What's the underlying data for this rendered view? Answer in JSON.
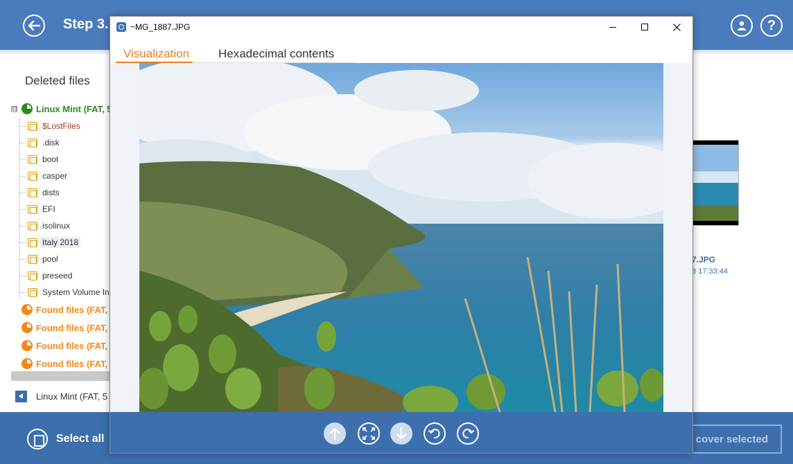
{
  "header": {
    "step_title": "Step 3.",
    "back_icon": "arrow-left-icon",
    "user_icon": "user-icon",
    "help_symbol": "?"
  },
  "tree": {
    "heading": "Deleted files",
    "root": {
      "label": "Linux Mint (FAT, 5",
      "expander": "⊟"
    },
    "items": [
      {
        "label": "$LostFiles"
      },
      {
        "label": ".disk"
      },
      {
        "label": "boot"
      },
      {
        "label": "casper"
      },
      {
        "label": "dists"
      },
      {
        "label": "EFI"
      },
      {
        "label": "isolinux"
      },
      {
        "label": "Italy 2018"
      },
      {
        "label": "pool"
      },
      {
        "label": "preseed"
      },
      {
        "label": "System Volume In"
      }
    ],
    "found": [
      {
        "label": "Found files (FAT,"
      },
      {
        "label": "Found files (FAT,"
      },
      {
        "label": "Found files (FAT,"
      },
      {
        "label": "Found files (FAT,"
      }
    ],
    "bottom_tab": "Linux Mint (FAT, 5"
  },
  "background_file": {
    "name": "7.JPG",
    "date": "8 17:33:44"
  },
  "footer": {
    "select_all": "Select all",
    "recover_selected": "cover selected"
  },
  "dialog": {
    "title": "~MG_1887.JPG",
    "tabs": [
      {
        "label": "Visualization",
        "active": true
      },
      {
        "label": "Hexadecimal contents",
        "active": false
      }
    ],
    "toolbar_icons": [
      "arrow-up-icon",
      "fit-screen-icon",
      "arrow-down-icon",
      "rotate-left-icon",
      "rotate-right-icon"
    ]
  },
  "colors": {
    "brand_blue": "#4a7bbd",
    "toolbar_blue": "#3d6fae",
    "accent_orange": "#e57f1f",
    "green_status": "#2d8a1e",
    "orange_status": "#f0891a"
  }
}
